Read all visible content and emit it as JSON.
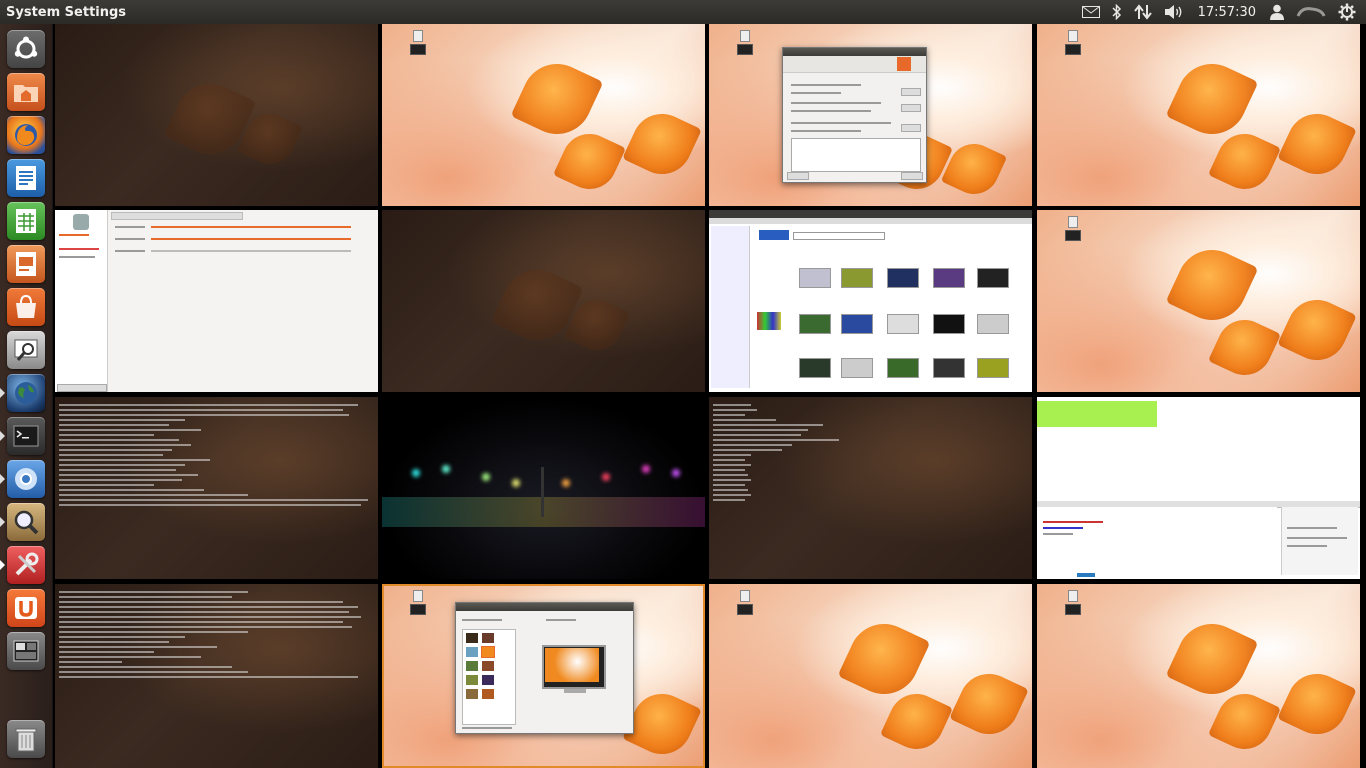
{
  "topbar": {
    "title": "System Settings",
    "clock": "17:57:30",
    "indicators": [
      "mail-icon",
      "bluetooth-icon",
      "network-icon",
      "volume-icon",
      "user-icon",
      "session-icon"
    ]
  },
  "launcher": {
    "items": [
      {
        "name": "dash-home",
        "icon": "ubuntu-logo-icon",
        "color": "#5b5b5b"
      },
      {
        "name": "home-folder",
        "icon": "folder-icon",
        "color": "#e36b2c"
      },
      {
        "name": "firefox",
        "icon": "firefox-icon",
        "color": "#e8761d"
      },
      {
        "name": "libreoffice-writer",
        "icon": "writer-icon",
        "color": "#2c78c0"
      },
      {
        "name": "libreoffice-calc",
        "icon": "calc-icon",
        "color": "#3c9a34"
      },
      {
        "name": "libreoffice-impress",
        "icon": "impress-icon",
        "color": "#d9682a"
      },
      {
        "name": "ubuntu-software-center",
        "icon": "software-center-icon",
        "color": "#e3642a"
      },
      {
        "name": "system-tool",
        "icon": "magnifier-tool-icon",
        "color": "#8a8a8a"
      },
      {
        "name": "earth-browser",
        "icon": "globe-icon",
        "color": "#20456f"
      },
      {
        "name": "terminal",
        "icon": "terminal-icon",
        "color": "#3a3a3a"
      },
      {
        "name": "chromium",
        "icon": "chromium-icon",
        "color": "#3b78c2"
      },
      {
        "name": "image-viewer",
        "icon": "magnifier-icon",
        "color": "#b08a50"
      },
      {
        "name": "system-settings",
        "icon": "settings-tools-icon",
        "color": "#d83a3a"
      },
      {
        "name": "ubuntu-one",
        "icon": "ubuntu-one-icon",
        "color": "#e45a1b"
      },
      {
        "name": "workspace-switcher",
        "icon": "workspace-switcher-icon",
        "color": "#6a6a6a"
      },
      {
        "name": "trash",
        "icon": "trash-icon",
        "color": "#6a6a6a"
      }
    ]
  },
  "workspaces": {
    "selected_index": 13
  }
}
